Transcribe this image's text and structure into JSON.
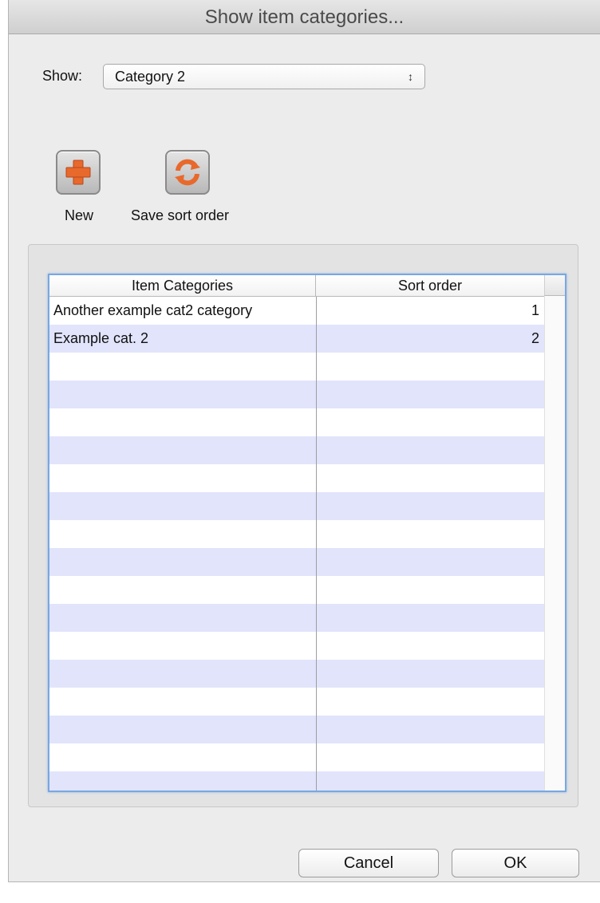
{
  "window": {
    "title": "Show item categories..."
  },
  "filter": {
    "label": "Show:",
    "selected": "Category 2",
    "arrows": "⇕"
  },
  "toolbar": {
    "new_label": "New",
    "save_sort_label": "Save sort order"
  },
  "table": {
    "columns": [
      "Item Categories",
      "Sort order"
    ],
    "rows": [
      {
        "category": "Another example cat2 category",
        "sort_order": "1"
      },
      {
        "category": "Example cat. 2",
        "sort_order": "2"
      }
    ],
    "empty_rows": 16
  },
  "footer": {
    "cancel_label": "Cancel",
    "ok_label": "OK"
  },
  "colors": {
    "row_alt": "#e1e4fb",
    "focus_ring": "#7aa7de",
    "icon_orange": "#e8692c"
  }
}
